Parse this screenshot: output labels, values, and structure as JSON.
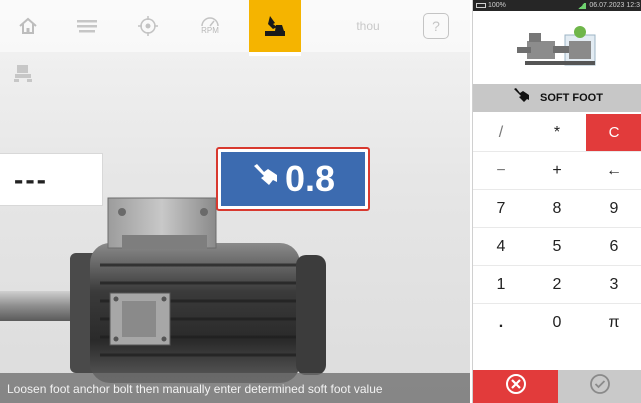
{
  "toolbar": {
    "items": [
      {
        "icon": "home-icon"
      },
      {
        "icon": "machine-list-icon"
      },
      {
        "icon": "settings-target-icon"
      },
      {
        "icon": "rpm-icon",
        "label": "RPM"
      },
      {
        "icon": "soft-foot-icon",
        "active": true
      },
      {
        "icon": "units-icon",
        "label": "thou"
      },
      {
        "icon": "help-icon",
        "label": "?"
      }
    ]
  },
  "left": {
    "sub_icon": "machine-feet-icon",
    "dash_value": "---",
    "soft_foot_value": "0.8",
    "status_text": "Loosen foot anchor bolt then manually enter determined soft foot value"
  },
  "system": {
    "battery": "100%",
    "datetime": "06.07.2023 12:3"
  },
  "mode": {
    "icon": "hand-push-icon",
    "label": "SOFT FOOT"
  },
  "keypad": {
    "rows": [
      [
        "/",
        "*",
        "C"
      ],
      [
        "−",
        "+",
        "←"
      ],
      [
        "7",
        "8",
        "9"
      ],
      [
        "4",
        "5",
        "6"
      ],
      [
        "1",
        "2",
        "3"
      ],
      [
        ".",
        "0",
        "π"
      ]
    ]
  },
  "actions": {
    "cancel_icon": "cancel-circle-icon",
    "ok_icon": "confirm-check-icon"
  },
  "colors": {
    "accent_yellow": "#f5b400",
    "value_blue": "#3c6bb0",
    "alert_red": "#e23b3b",
    "highlight_border": "#d8392f"
  }
}
